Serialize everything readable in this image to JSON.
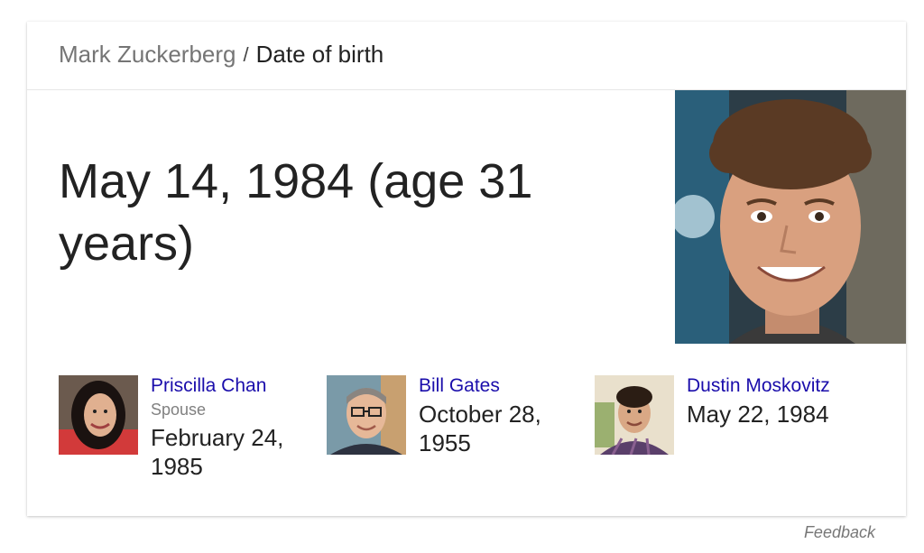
{
  "breadcrumb": {
    "entity": "Mark Zuckerberg",
    "separator": "/",
    "attribute": "Date of birth"
  },
  "answer": {
    "text": "May 14, 1984 (age 31 years)"
  },
  "related": [
    {
      "name": "Priscilla Chan",
      "role": "Spouse",
      "date": "February 24, 1985"
    },
    {
      "name": "Bill Gates",
      "role": "",
      "date": "October 28, 1955"
    },
    {
      "name": "Dustin Moskovitz",
      "role": "",
      "date": "May 22, 1984"
    }
  ],
  "feedback": "Feedback",
  "colors": {
    "link": "#1a0dab",
    "text": "#222222",
    "muted": "#757575"
  }
}
